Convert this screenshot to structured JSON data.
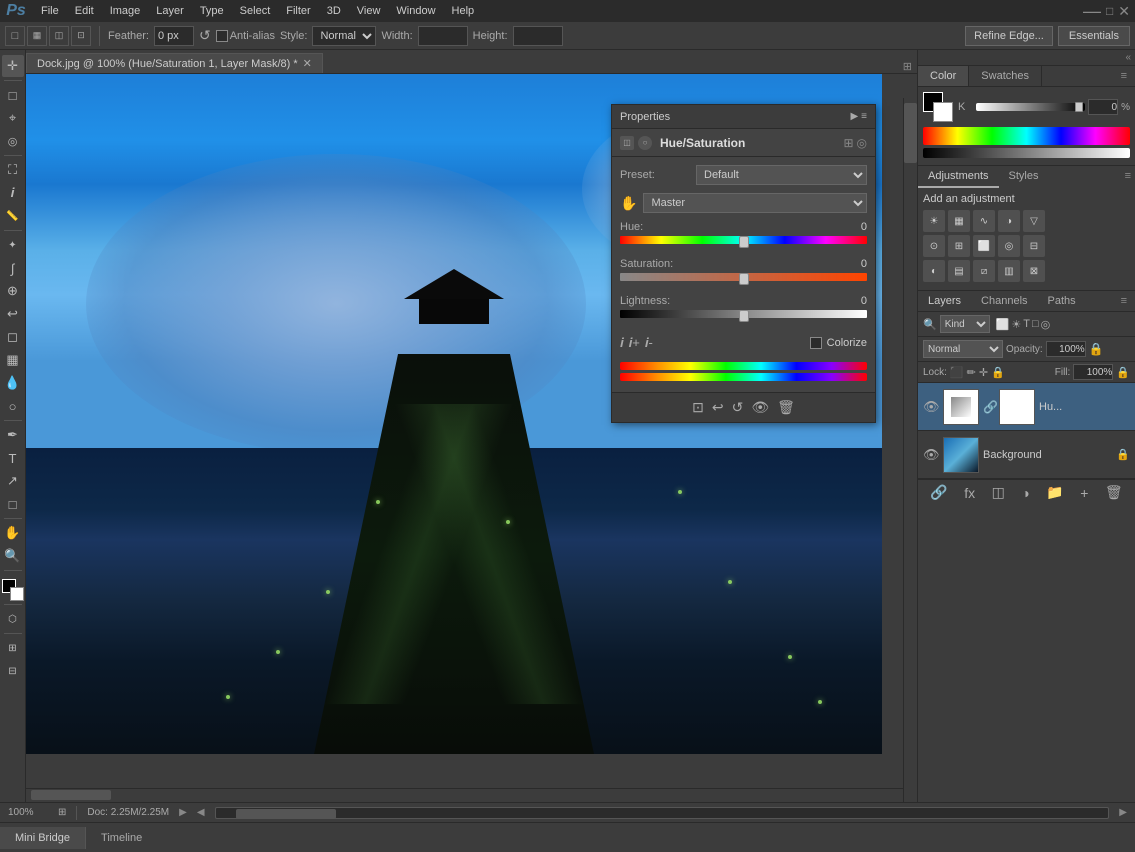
{
  "app": {
    "title": "Adobe Photoshop",
    "logo": "Ps"
  },
  "menubar": {
    "items": [
      "File",
      "Edit",
      "Image",
      "Layer",
      "Type",
      "Select",
      "Filter",
      "3D",
      "View",
      "Window",
      "Help"
    ]
  },
  "optionsbar": {
    "feather_label": "Feather:",
    "feather_value": "0 px",
    "antialiasLabel": "Anti-alias",
    "style_label": "Style:",
    "style_value": "Normal",
    "width_label": "Width:",
    "height_label": "Height:",
    "refine_btn": "Refine Edge...",
    "essentials_btn": "Essentials"
  },
  "tab": {
    "filename": "Dock.jpg @ 100% (Hue/Saturation 1, Layer Mask/8) *"
  },
  "properties": {
    "title": "Properties",
    "panel_title": "Hue/Saturation",
    "preset_label": "Preset:",
    "preset_value": "Default",
    "channel_label": "Master",
    "hue_label": "Hue:",
    "hue_value": "0",
    "sat_label": "Saturation:",
    "sat_value": "0",
    "light_label": "Lightness:",
    "light_value": "0",
    "colorize_label": "Colorize"
  },
  "right_panel": {
    "color_tab": "Color",
    "swatches_tab": "Swatches",
    "channel_k": "K",
    "channel_k_value": "0",
    "channel_pct": "%"
  },
  "adjustments": {
    "tab": "Adjustments",
    "styles_tab": "Styles",
    "title": "Add an adjustment"
  },
  "layers": {
    "tab": "Layers",
    "channels_tab": "Channels",
    "paths_tab": "Paths",
    "kind_label": "Kind",
    "blend_mode": "Normal",
    "opacity_label": "Opacity:",
    "opacity_value": "100%",
    "lock_label": "Lock:",
    "fill_label": "Fill:",
    "fill_value": "100%",
    "layer1_name": "Hu...",
    "layer2_name": "Background",
    "search_placeholder": ""
  },
  "statusbar": {
    "zoom": "100%",
    "doc_info": "Doc: 2.25M/2.25M"
  },
  "minibridge": {
    "bridge_label": "Mini Bridge",
    "timeline_label": "Timeline"
  }
}
